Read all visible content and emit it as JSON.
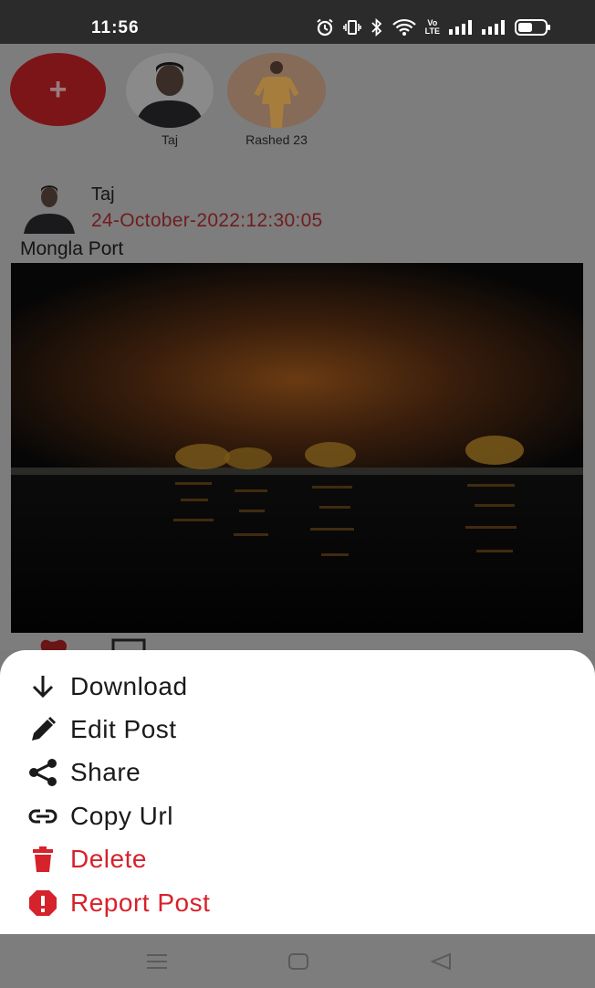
{
  "status_bar": {
    "time": "11:56",
    "icons": [
      "alarm-icon",
      "vibrate-icon",
      "bluetooth-icon",
      "wifi-icon",
      "volte-icon",
      "signal-icon",
      "signal-icon",
      "battery-icon"
    ],
    "volte_top": "Vo",
    "volte_bottom": "LTE"
  },
  "stories": {
    "add_label": "+",
    "items": [
      {
        "name": "Taj"
      },
      {
        "name": "Rashed 23"
      }
    ]
  },
  "post": {
    "user": "Taj",
    "timestamp": "24-October-2022:12:30:05",
    "caption": "Mongla Port"
  },
  "menu": {
    "items": [
      {
        "label": "Download",
        "icon": "download-icon"
      },
      {
        "label": "Edit Post",
        "icon": "edit-icon"
      },
      {
        "label": "Share",
        "icon": "share-icon"
      },
      {
        "label": "Copy Url",
        "icon": "link-icon"
      },
      {
        "label": "Delete",
        "icon": "delete-icon"
      },
      {
        "label": "Report Post",
        "icon": "report-icon"
      }
    ]
  },
  "colors": {
    "accent": "#d6222b",
    "sheet": "#ffffff",
    "scrim": "#7d7d7d"
  }
}
